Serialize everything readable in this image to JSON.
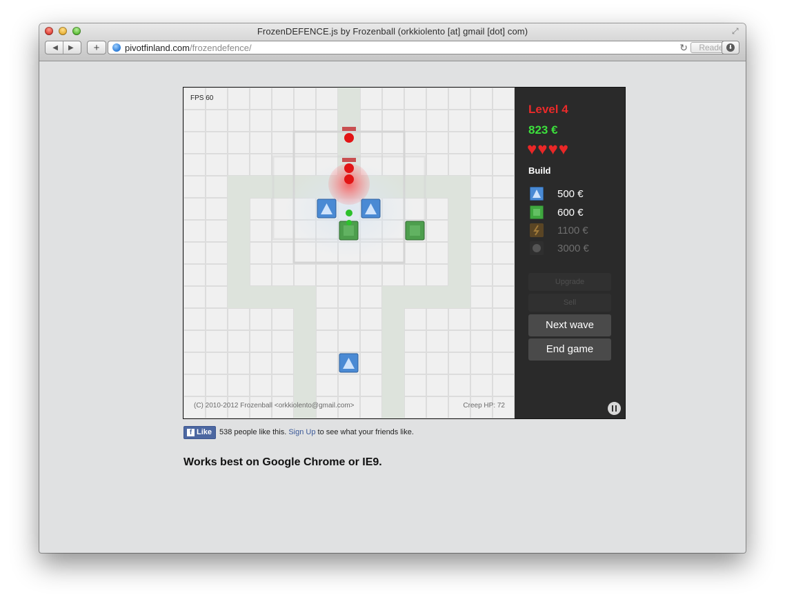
{
  "window": {
    "title": "FrozenDEFENCE.js by Frozenball (orkkiolento [at] gmail [dot] com)",
    "url_host": "pivotfinland.com",
    "url_path": "/frozendefence/",
    "reader_label": "Reader"
  },
  "game": {
    "fps": "FPS 60",
    "copyright": "(C) 2010-2012 Frozenball <orkkiolento@gmail.com>",
    "creep_hp": "Creep HP: 72",
    "level": "Level 4",
    "money": "823 €",
    "lives": 4,
    "build_label": "Build",
    "shop": [
      {
        "icon": "blue-triangle-tower-icon",
        "price": "500 €",
        "affordable": true,
        "color": "#4a8ad4"
      },
      {
        "icon": "green-square-tower-icon",
        "price": "600 €",
        "affordable": true,
        "color": "#3fa73f"
      },
      {
        "icon": "lightning-tower-icon",
        "price": "1100 €",
        "affordable": false,
        "color": "#7a5a2a"
      },
      {
        "icon": "bomb-tower-icon",
        "price": "3000 €",
        "affordable": false,
        "color": "#555555"
      }
    ],
    "buttons": {
      "upgrade": "Upgrade",
      "sell": "Sell",
      "next_wave": "Next wave",
      "end_game": "End game"
    }
  },
  "facebook": {
    "like_label": "Like",
    "count_text": "538 people like this.",
    "signup_link": "Sign Up",
    "signup_suffix": "to see what your friends like."
  },
  "note": "Works best on Google Chrome or IE9.",
  "colors": {
    "level": "#ea2a2a",
    "money": "#3ce03c",
    "heart": "#e92727",
    "panel_bg": "#2a2a2a"
  }
}
